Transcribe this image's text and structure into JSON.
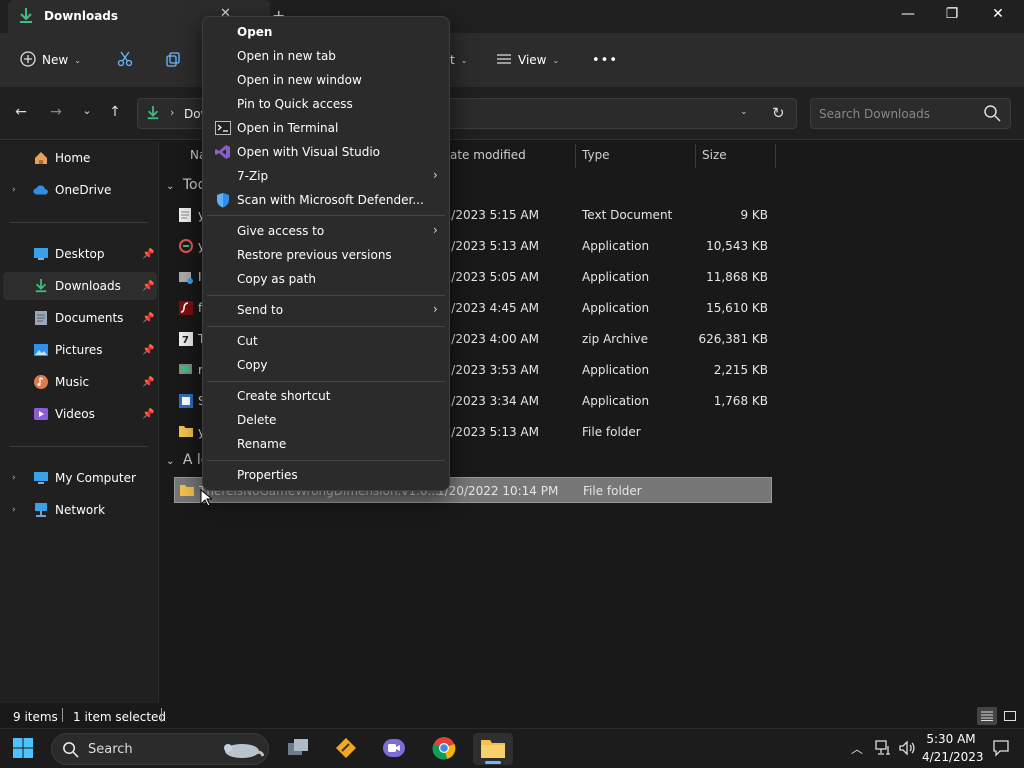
{
  "window": {
    "tab_title": "Downloads",
    "new_tab": "+",
    "minimize": "—",
    "maximize": "❐",
    "close": "✕"
  },
  "commandbar": {
    "new_label": "New",
    "view_label": "View",
    "sort_partial": "t",
    "more": "•••"
  },
  "address": {
    "crumb": "Dow",
    "search_placeholder": "Search Downloads"
  },
  "sidebar": {
    "items": [
      {
        "label": "Home",
        "pinned": false
      },
      {
        "label": "OneDrive",
        "pinned": false
      },
      {
        "label": "Desktop",
        "pinned": true
      },
      {
        "label": "Downloads",
        "pinned": true
      },
      {
        "label": "Documents",
        "pinned": true
      },
      {
        "label": "Pictures",
        "pinned": true
      },
      {
        "label": "Music",
        "pinned": true
      },
      {
        "label": "Videos",
        "pinned": true
      },
      {
        "label": "My Computer",
        "pinned": false
      },
      {
        "label": "Network",
        "pinned": false
      }
    ]
  },
  "columns": {
    "name": "Na",
    "date": "ate modified",
    "type": "Type",
    "size": "Size"
  },
  "groups": {
    "today": "Tod",
    "long_ago": "A lo"
  },
  "files": [
    {
      "name": "y",
      "date": "21/2023 5:15 AM",
      "type": "Text Document",
      "size": "9 KB"
    },
    {
      "name": "y",
      "date": "21/2023 5:13 AM",
      "type": "Application",
      "size": "10,543 KB"
    },
    {
      "name": "I",
      "date": "21/2023 5:05 AM",
      "type": "Application",
      "size": "11,868 KB"
    },
    {
      "name": "f",
      "date": "21/2023 4:45 AM",
      "type": "Application",
      "size": "15,610 KB"
    },
    {
      "name": "T",
      "date": "21/2023 4:00 AM",
      "type": "zip Archive",
      "size": "626,381 KB"
    },
    {
      "name": "r",
      "date": "21/2023 3:53 AM",
      "type": "Application",
      "size": "2,215 KB"
    },
    {
      "name": "S",
      "date": "21/2023 3:34 AM",
      "type": "Application",
      "size": "1,768 KB"
    },
    {
      "name": "y",
      "date": "21/2023 5:13 AM",
      "type": "File folder",
      "size": ""
    }
  ],
  "old_files": [
    {
      "name": "ThereIsNoGameWrongDimension.v1.0...",
      "date": "1/20/2022 10:14 PM",
      "type": "File folder",
      "size": ""
    }
  ],
  "context_menu": {
    "open": "Open",
    "open_new_tab": "Open in new tab",
    "open_new_window": "Open in new window",
    "pin_quick": "Pin to Quick access",
    "open_terminal": "Open in Terminal",
    "open_vs": "Open with Visual Studio",
    "zip7": "7-Zip",
    "defender": "Scan with Microsoft Defender...",
    "give_access": "Give access to",
    "restore": "Restore previous versions",
    "copy_path": "Copy as path",
    "send_to": "Send to",
    "cut": "Cut",
    "copy": "Copy",
    "create_shortcut": "Create shortcut",
    "delete": "Delete",
    "rename": "Rename",
    "properties": "Properties"
  },
  "status": {
    "items": "9 items",
    "selected": "1 item selected"
  },
  "taskbar": {
    "search_label": "Search",
    "time": "5:30 AM",
    "date": "4/21/2023"
  },
  "colors": {
    "accent": "#4cc2ff",
    "download_green": "#3fbf7f",
    "folder_yellow": "#f2c14e"
  }
}
